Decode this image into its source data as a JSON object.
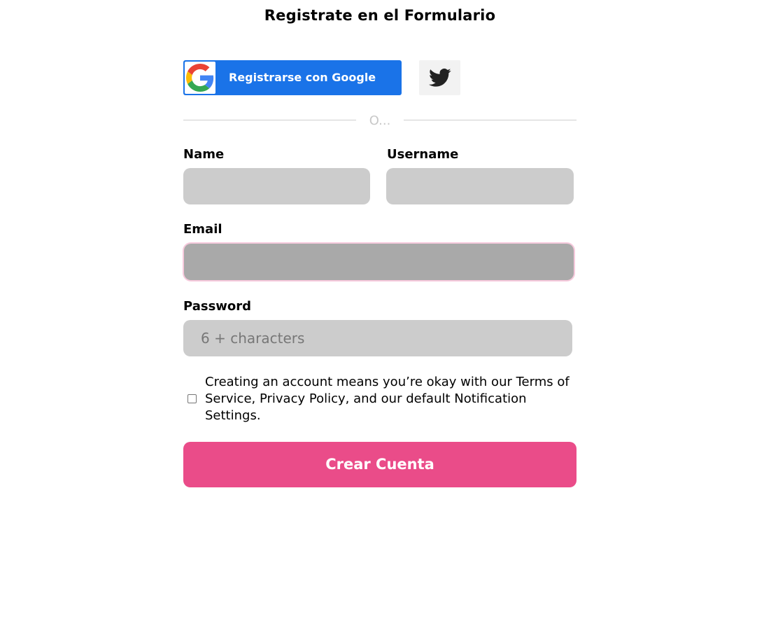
{
  "header": {
    "title": "Registrate en el Formulario"
  },
  "social": {
    "google_label": "Registrarse con Google",
    "google_icon": "google-g-logo",
    "twitter_icon": "twitter-bird"
  },
  "divider": {
    "text": "O..."
  },
  "form": {
    "name_label": "Name",
    "name_value": "",
    "username_label": "Username",
    "username_value": "",
    "email_label": "Email",
    "email_value": "",
    "password_label": "Password",
    "password_placeholder": "6 + characters",
    "password_value": "",
    "terms_checked": false,
    "terms_text": "Creating an account means you’re okay with our Terms of Service, Privacy Policy, and our default Notification Settings.",
    "submit_label": "Crear Cuenta"
  },
  "colors": {
    "google_blue": "#1a73e8",
    "submit_pink": "#ea4c89",
    "input_gray": "#cccccc",
    "input_focused_gray": "#a9a9a9",
    "focus_ring": "#f6c9dc",
    "twitter_bg": "#f2f2f2"
  }
}
